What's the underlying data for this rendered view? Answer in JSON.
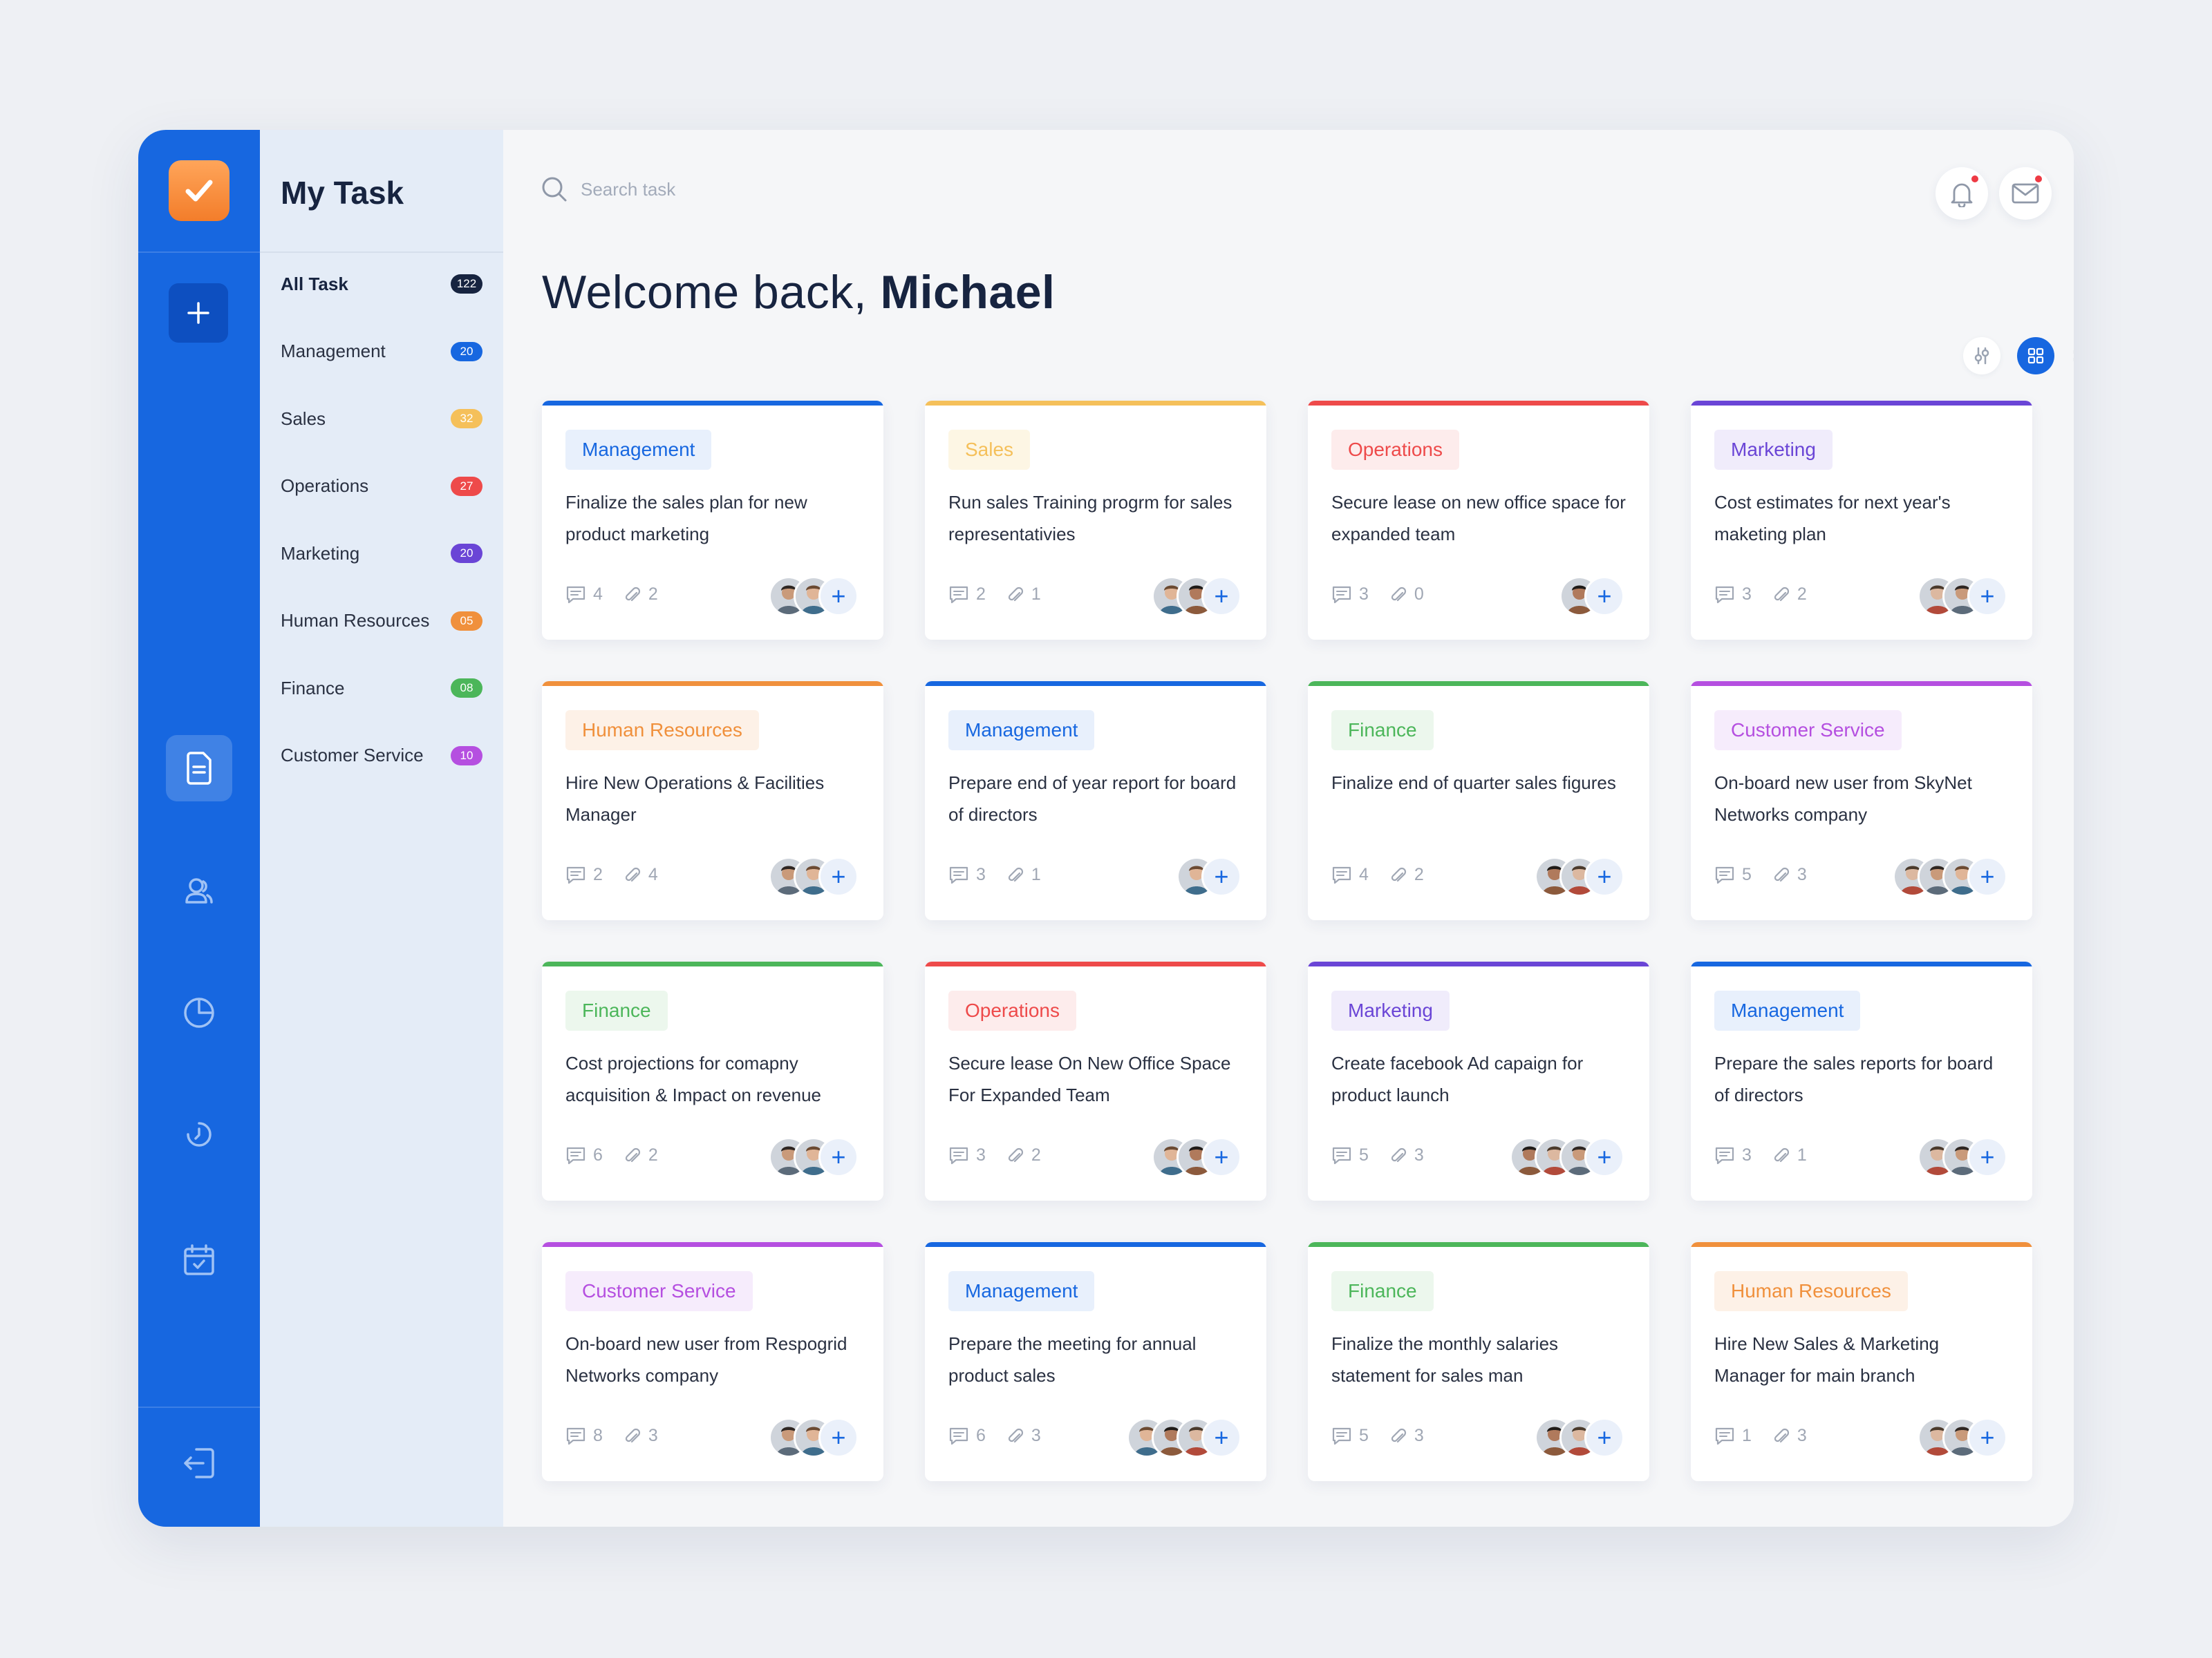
{
  "sidebar_rail": {
    "icons": [
      "logo-check-icon",
      "plus-icon",
      "document-icon",
      "users-icon",
      "pie-chart-icon",
      "history-icon",
      "calendar-icon",
      "logout-icon"
    ]
  },
  "categories": {
    "title": "My Task",
    "items": [
      {
        "label": "All Task",
        "count": "122",
        "color": "#172440"
      },
      {
        "label": "Management",
        "count": "20",
        "color": "#1767e0"
      },
      {
        "label": "Sales",
        "count": "32",
        "color": "#f5c05a"
      },
      {
        "label": "Operations",
        "count": "27",
        "color": "#ee4a4a"
      },
      {
        "label": "Marketing",
        "count": "20",
        "color": "#6a45d6"
      },
      {
        "label": "Human Resources",
        "count": "05",
        "color": "#f0903c"
      },
      {
        "label": "Finance",
        "count": "08",
        "color": "#4cb65a"
      },
      {
        "label": "Customer Service",
        "count": "10",
        "color": "#b54fe0"
      }
    ]
  },
  "header": {
    "search_placeholder": "Search task",
    "welcome_prefix": "Welcome back, ",
    "user_name": "Michael"
  },
  "cards": [
    {
      "tag": "Management",
      "title": "Finalize the sales plan for new product marketing",
      "comments": "4",
      "attachments": "2",
      "color": "#1767e0",
      "tag_bg": "#e8f0fc",
      "avatars": 2
    },
    {
      "tag": "Sales",
      "title": "Run sales Training progrm for sales representativies",
      "comments": "2",
      "attachments": "1",
      "color": "#f5c05a",
      "tag_bg": "#fdf6e4",
      "avatars": 2
    },
    {
      "tag": "Operations",
      "title": "Secure lease on new office space for expanded team",
      "comments": "3",
      "attachments": "0",
      "color": "#ee4a4a",
      "tag_bg": "#fdecec",
      "avatars": 1
    },
    {
      "tag": "Marketing",
      "title": "Cost estimates for next year's maketing plan",
      "comments": "3",
      "attachments": "2",
      "color": "#6a45d6",
      "tag_bg": "#f0ecfb",
      "avatars": 2
    },
    {
      "tag": "Human Resources",
      "title": "Hire New Operations & Facilities Manager",
      "comments": "2",
      "attachments": "4",
      "color": "#f0903c",
      "tag_bg": "#fdf1e7",
      "avatars": 2
    },
    {
      "tag": "Management",
      "title": "Prepare end of year report for board of directors",
      "comments": "3",
      "attachments": "1",
      "color": "#1767e0",
      "tag_bg": "#e8f0fc",
      "avatars": 1
    },
    {
      "tag": "Finance",
      "title": "Finalize end of quarter sales figures",
      "comments": "4",
      "attachments": "2",
      "color": "#4cb65a",
      "tag_bg": "#ecf7ed",
      "avatars": 2
    },
    {
      "tag": "Customer Service",
      "title": "On-board new user from SkyNet Networks company",
      "comments": "5",
      "attachments": "3",
      "color": "#b54fe0",
      "tag_bg": "#f6ecfc",
      "avatars": 3
    },
    {
      "tag": "Finance",
      "title": "Cost projections for comapny acquisition & Impact on revenue",
      "comments": "6",
      "attachments": "2",
      "color": "#4cb65a",
      "tag_bg": "#ecf7ed",
      "avatars": 2
    },
    {
      "tag": "Operations",
      "title": "Secure lease On New Office Space For Expanded Team",
      "comments": "3",
      "attachments": "2",
      "color": "#ee4a4a",
      "tag_bg": "#fdecec",
      "avatars": 2
    },
    {
      "tag": "Marketing",
      "title": "Create facebook Ad capaign for product launch",
      "comments": "5",
      "attachments": "3",
      "color": "#6a45d6",
      "tag_bg": "#f0ecfb",
      "avatars": 3
    },
    {
      "tag": "Management",
      "title": "Prepare the sales reports for board of directors",
      "comments": "3",
      "attachments": "1",
      "color": "#1767e0",
      "tag_bg": "#e8f0fc",
      "avatars": 2
    },
    {
      "tag": "Customer Service",
      "title": "On-board new user from Respogrid Networks company",
      "comments": "8",
      "attachments": "3",
      "color": "#b54fe0",
      "tag_bg": "#f6ecfc",
      "avatars": 2
    },
    {
      "tag": "Management",
      "title": "Prepare the meeting for annual product sales",
      "comments": "6",
      "attachments": "3",
      "color": "#1767e0",
      "tag_bg": "#e8f0fc",
      "avatars": 3
    },
    {
      "tag": "Finance",
      "title": "Finalize the monthly salaries statement for sales man",
      "comments": "5",
      "attachments": "3",
      "color": "#4cb65a",
      "tag_bg": "#ecf7ed",
      "avatars": 2
    },
    {
      "tag": "Human Resources",
      "title": "Hire New Sales & Marketing Manager for main branch",
      "comments": "1",
      "attachments": "3",
      "color": "#f0903c",
      "tag_bg": "#fdf1e7",
      "avatars": 2
    }
  ]
}
